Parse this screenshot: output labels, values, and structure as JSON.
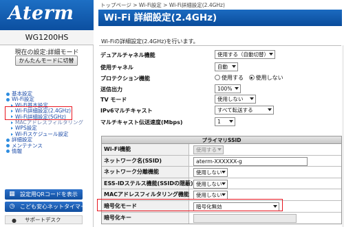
{
  "sidebar": {
    "logo": "Aterm",
    "model": "WG1200HS",
    "mode_label": "現在の設定:詳細モード",
    "mode_button": "かんたんモードに切替",
    "nav": [
      {
        "label": "基本設定",
        "level": 1
      },
      {
        "label": "Wi-Fi設定",
        "level": 1
      },
      {
        "label": "Wi-Fi基本設定",
        "level": 2
      },
      {
        "label": "Wi-Fi詳細設定(2.4GHz)",
        "level": 2,
        "active": true
      },
      {
        "label": "Wi-Fi詳細設定(5GHz)",
        "level": 2,
        "active": true
      },
      {
        "label": "MACアドレスフィルタリング",
        "level": 2
      },
      {
        "label": "WPS設定",
        "level": 2
      },
      {
        "label": "Wi-Fiスケジュール設定",
        "level": 2
      },
      {
        "label": "詳細設定",
        "level": 1
      },
      {
        "label": "メンテナンス",
        "level": 1
      },
      {
        "label": "情報",
        "level": 1
      }
    ],
    "qr_button": "設定用QRコードを表示",
    "kids_button": "こども安心ネットタイマー",
    "support_button": "サポートデスク"
  },
  "main": {
    "breadcrumb": "トップページ > Wi-Fi設定 > Wi-Fi詳細設定(2.4GHz)",
    "title": "Wi-Fi 詳細設定(2.4GHz)",
    "description": "Wi-Fiの詳細設定(2.4GHz)を行います。",
    "settings": {
      "dual_channel": {
        "label": "デュアルチャネル機能",
        "value": "使用する（自動切替）"
      },
      "channel": {
        "label": "使用チャネル",
        "value": "自動"
      },
      "protection": {
        "label": "プロテクション機能",
        "option_use": "使用する",
        "option_nouse": "使用しない",
        "selected": "使用しない"
      },
      "tx_power": {
        "label": "送信出力",
        "value": "100%"
      },
      "tv_mode": {
        "label": "TV モード",
        "value": "使用しない"
      },
      "ipv6_multicast": {
        "label": "IPv6マルチキャスト",
        "value": "すべて転送する"
      },
      "multicast_rate": {
        "label": "マルチキャスト伝送速度(Mbps)",
        "value": "1"
      }
    },
    "ssid_table": {
      "header": "プライマリSSID",
      "rows": {
        "wifi": {
          "label": "Wi-Fi機能",
          "value": "使用する"
        },
        "ssid": {
          "label": "ネットワーク名(SSID)",
          "value": "aterm-XXXXXX-g"
        },
        "separation": {
          "label": "ネットワーク分離機能",
          "value": "使用しない"
        },
        "stealth": {
          "label": "ESS-IDステルス機能(SSIDの隠蔽)",
          "value": "使用しない"
        },
        "mac_filter": {
          "label": "MACアドレスフィルタリング機能",
          "value": "使用しない"
        },
        "encryption": {
          "label": "暗号化モード",
          "value": "暗号化無効"
        },
        "key": {
          "label": "暗号化キー",
          "value": ""
        }
      }
    }
  },
  "colors": {
    "brand_blue": "#0c4fa0",
    "highlight_red": "#e8141e",
    "link_blue": "#1a4aa8"
  }
}
